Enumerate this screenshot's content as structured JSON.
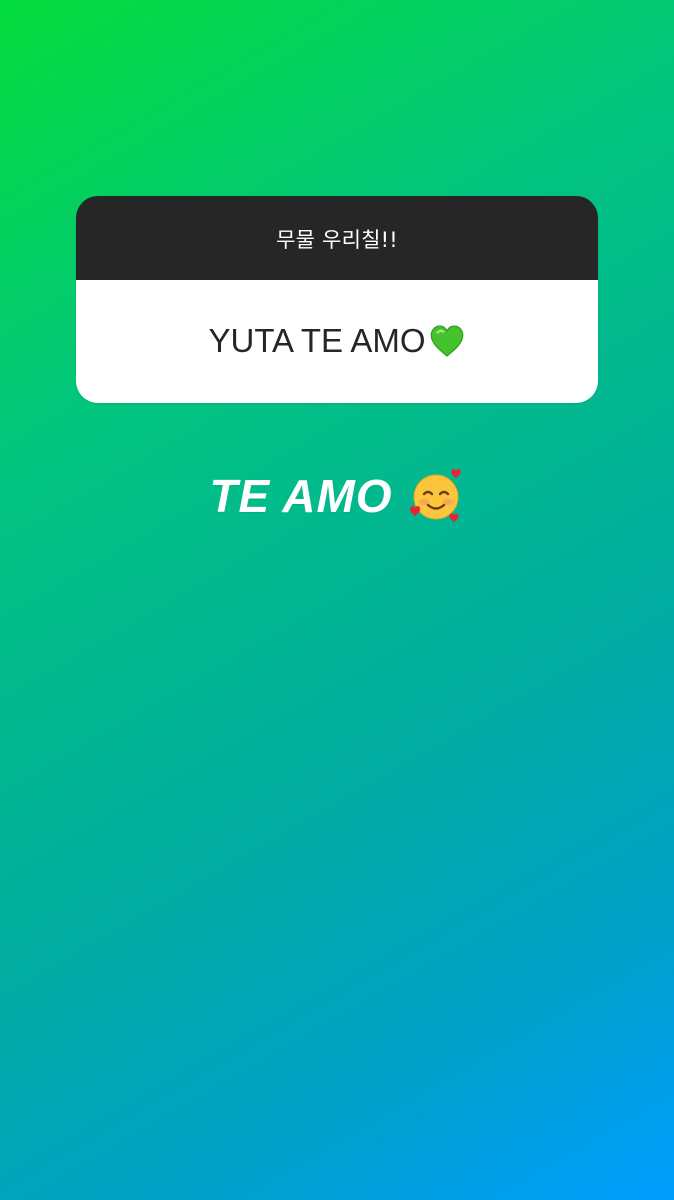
{
  "question_sticker": {
    "question": "무물 우리칠!!",
    "answer": "YUTA TE AMO"
  },
  "text_sticker": {
    "text": "TE AMO"
  },
  "icons": {
    "answer_emoji": "green-heart-icon",
    "text_emoji": "smiling-face-with-hearts-icon"
  },
  "colors": {
    "gradient_start": "#05dd3c",
    "gradient_end": "#009dff",
    "card_header": "#262626",
    "card_body": "#ffffff",
    "heart": "#3fbf2a"
  }
}
